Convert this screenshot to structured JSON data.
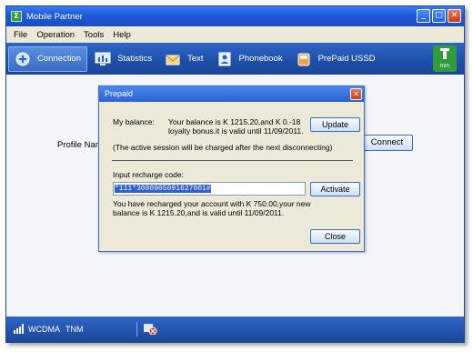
{
  "window": {
    "title": "Mobile Partner"
  },
  "menu": [
    "File",
    "Operation",
    "Tools",
    "Help"
  ],
  "toolbar": {
    "items": [
      {
        "label": "Connection",
        "icon": "connection-icon"
      },
      {
        "label": "Statistics",
        "icon": "statistics-icon"
      },
      {
        "label": "Text",
        "icon": "text-message-icon"
      },
      {
        "label": "Phonebook",
        "icon": "phonebook-icon"
      },
      {
        "label": "PrePaid USSD",
        "icon": "prepaid-ussd-icon"
      }
    ],
    "logo": "tnm"
  },
  "main": {
    "profile_label": "Profile Name",
    "connect_label": "Connect"
  },
  "dialog": {
    "title": "Prepaid",
    "balance_label": "My balance:",
    "balance_text_line1": "Your balance is K 1215.20,and K 0.-18",
    "balance_text_line2": "loyalty bonus.it is valid until 11/09/2011.",
    "update_label": "Update",
    "session_note": "(The active session will be charged after the next disconnecting)",
    "input_label": "Input recharge code:",
    "input_value": "*111*3080905091627001#",
    "activate_label": "Activate",
    "result_line1": "You have recharged your account with K 750.00,your new",
    "result_line2": "balance is K 1215.20,and is valid until 11/09/2011.",
    "close_label": "Close"
  },
  "statusbar": {
    "network": "WCDMA",
    "operator": "TNM"
  },
  "colors": {
    "accent": "#1d4fa7",
    "titlebar": "#1b58d8",
    "dialog_bg": "#ece9d8"
  }
}
